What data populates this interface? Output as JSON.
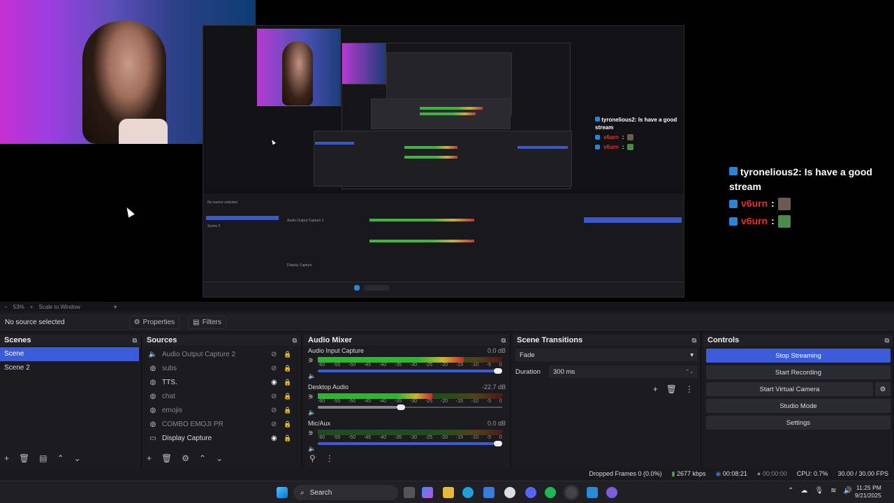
{
  "window_controls": {
    "minimize": "—",
    "maximize": "❐",
    "close": "✕"
  },
  "chat": {
    "large": {
      "user1": "tyronelious2",
      "msg1": ": Is have a good stream",
      "user2": "v6urn",
      "sep": ":"
    },
    "small": {
      "user1": "tyronelious2",
      "msg1": ": Is have a good stream",
      "user2": "v6urn",
      "sep": ":"
    }
  },
  "zoom_bar": {
    "zoom_out": "−",
    "zoom": "53%",
    "zoom_in": "+",
    "scale": "Scale to Window",
    "dropdown": "▾"
  },
  "prop_bar": {
    "no_source": "No source selected",
    "properties": "Properties",
    "filters": "Filters"
  },
  "scenes": {
    "title": "Scenes",
    "items": [
      "Scene",
      "Scene 2"
    ]
  },
  "sources": {
    "title": "Sources",
    "items": [
      {
        "label": "Audio Output Capture 2",
        "icon": "speaker-icon"
      },
      {
        "label": "subs",
        "icon": "browser-icon"
      },
      {
        "label": "TTS.",
        "icon": "browser-icon"
      },
      {
        "label": "chat",
        "icon": "browser-icon"
      },
      {
        "label": "emojis",
        "icon": "browser-icon"
      },
      {
        "label": "COMBO EMOJI PR",
        "icon": "browser-icon"
      },
      {
        "label": "Display Capture",
        "icon": "display-icon"
      }
    ]
  },
  "audio_mixer": {
    "title": "Audio Mixer",
    "channels": [
      {
        "name": "Audio Input Capture",
        "db": "0.0 dB",
        "level": 0.79,
        "volume": 1.0
      },
      {
        "name": "Desktop Audio",
        "db": "-22.7 dB",
        "level": 0.62,
        "volume": 0.45
      },
      {
        "name": "Mic/Aux",
        "db": "0.0 dB",
        "level": 0.0,
        "volume": 1.0
      }
    ],
    "ticks": [
      "-60",
      "-55",
      "-50",
      "-45",
      "-40",
      "-35",
      "-30",
      "-25",
      "-20",
      "-15",
      "-10",
      "-5",
      "0"
    ]
  },
  "transitions": {
    "title": "Scene Transitions",
    "type": "Fade",
    "duration_label": "Duration",
    "duration_value": "300 ms"
  },
  "controls": {
    "title": "Controls",
    "stop_streaming": "Stop Streaming",
    "start_recording": "Start Recording",
    "start_virtual_camera": "Start Virtual Camera",
    "studio_mode": "Studio Mode",
    "settings": "Settings"
  },
  "status": {
    "dropped": "Dropped Frames 0 (0.0%)",
    "bitrate": "2677 kbps",
    "stream_time": "00:08:21",
    "rec_time": "00:00:00",
    "cpu": "CPU: 0.7%",
    "fps": "30.00 / 30.00 FPS"
  },
  "taskbar": {
    "search": "Search",
    "time": "11:25 PM",
    "date": "9/21/2025"
  },
  "colors": {
    "accent": "#3b5cd8",
    "red_user": "#e8302c",
    "twitch_icon": "#2b84d8"
  }
}
